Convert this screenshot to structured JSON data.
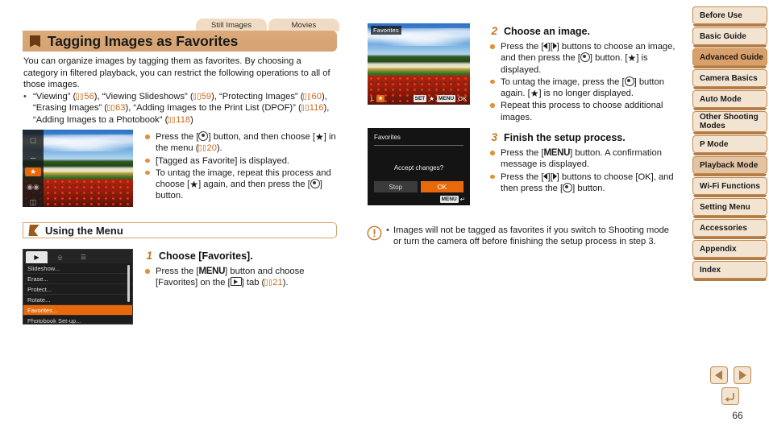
{
  "topic_tabs": [
    {
      "label": "Still Images"
    },
    {
      "label": "Movies"
    }
  ],
  "title": "Tagging Images as Favorites",
  "intro": "You can organize images by tagging them as favorites. By choosing a category in filtered playback, you can restrict the following operations to all of those images.",
  "related_bullet": {
    "parts": [
      {
        "text": "“Viewing” ("
      },
      {
        "ref": "56"
      },
      {
        "text": "), “Viewing Slideshows” ("
      },
      {
        "ref": "59"
      },
      {
        "text": "), “Protecting Images” ("
      },
      {
        "ref": "60"
      },
      {
        "text": "), “Erasing Images” ("
      },
      {
        "ref": "63"
      },
      {
        "text": "), “Adding Images to the Print List (DPOF)” ("
      },
      {
        "ref": "116"
      },
      {
        "text": "), “Adding Images to a Photobook” ("
      },
      {
        "ref": "118"
      },
      {
        "text": ")"
      }
    ]
  },
  "screens": {
    "photo_favorites": {
      "name": "favorites-filter-photo",
      "icons": [
        "folder-icon",
        "date-icon",
        "star-icon",
        "people-icon",
        "file-icon"
      ],
      "selected_icon_index": 2
    },
    "photo_choose": {
      "label": "Favorites",
      "quality_badge": "L",
      "set_chip": "SET",
      "star_glyph": "★",
      "menu_chip": "MENU",
      "ok_label": "OK"
    },
    "accept_changes": {
      "title": "Favorites",
      "message": "Accept changes?",
      "buttons": [
        "Stop",
        "OK"
      ],
      "active_button_index": 1,
      "footer_chip": "MENU",
      "footer_glyph": "↵"
    },
    "menu_list": {
      "tabs": [
        "play-tab",
        "print-tab",
        "settings-tab"
      ],
      "selected_tab_index": 0,
      "rows": [
        "Slideshow...",
        "Erase...",
        "Protect...",
        "Rotate...",
        "Favorites...",
        "Photobook Set-up..."
      ],
      "selected_row_index": 4
    }
  },
  "left_steps": {
    "intro_items": [
      {
        "segments": [
          {
            "text": "Press the ["
          },
          {
            "glyph": "set"
          },
          {
            "text": "] button, and then choose ["
          },
          {
            "glyph": "star"
          },
          {
            "text": "] in the menu ("
          },
          {
            "ref": "20"
          },
          {
            "text": ")."
          }
        ]
      },
      {
        "segments": [
          {
            "text": "[Tagged as Favorite] is displayed."
          }
        ]
      },
      {
        "segments": [
          {
            "text": "To untag the image, repeat this process and choose ["
          },
          {
            "glyph": "star"
          },
          {
            "text": "] again, and then press the ["
          },
          {
            "glyph": "set"
          },
          {
            "text": "] button."
          }
        ]
      }
    ]
  },
  "subsection": {
    "title": "Using the Menu"
  },
  "steps": [
    {
      "number": "1",
      "heading": "Choose [Favorites].",
      "items": [
        {
          "segments": [
            {
              "text": "Press the ["
            },
            {
              "glyph": "menu"
            },
            {
              "text": "] button and choose [Favorites] on the ["
            },
            {
              "glyph": "play"
            },
            {
              "text": "] tab ("
            },
            {
              "ref": "21"
            },
            {
              "text": ")."
            }
          ]
        }
      ]
    },
    {
      "number": "2",
      "heading": "Choose an image.",
      "items": [
        {
          "segments": [
            {
              "text": "Press the ["
            },
            {
              "glyph": "arrow-l"
            },
            {
              "text": "]["
            },
            {
              "glyph": "arrow-r"
            },
            {
              "text": "] buttons to choose an image, and then press the ["
            },
            {
              "glyph": "set"
            },
            {
              "text": "] button. ["
            },
            {
              "glyph": "star"
            },
            {
              "text": "] is displayed."
            }
          ]
        },
        {
          "segments": [
            {
              "text": "To untag the image, press the ["
            },
            {
              "glyph": "set"
            },
            {
              "text": "] button again. ["
            },
            {
              "glyph": "star"
            },
            {
              "text": "] is no longer displayed."
            }
          ]
        },
        {
          "segments": [
            {
              "text": "Repeat this process to choose additional images."
            }
          ]
        }
      ]
    },
    {
      "number": "3",
      "heading": "Finish the setup process.",
      "items": [
        {
          "segments": [
            {
              "text": "Press the ["
            },
            {
              "glyph": "menu"
            },
            {
              "text": "] button. A confirmation message is displayed."
            }
          ]
        },
        {
          "segments": [
            {
              "text": "Press the ["
            },
            {
              "glyph": "arrow-l"
            },
            {
              "text": "]["
            },
            {
              "glyph": "arrow-r"
            },
            {
              "text": "] buttons to choose [OK], and then press the ["
            },
            {
              "glyph": "set"
            },
            {
              "text": "] button."
            }
          ]
        }
      ]
    }
  ],
  "note": {
    "icon": "caution-icon",
    "bullet": "•",
    "text": "Images will not be tagged as favorites if you switch to Shooting mode or turn the camera off before finishing the setup process in step 3."
  },
  "sidebar": {
    "items": [
      {
        "label": "Before Use",
        "style": "normal"
      },
      {
        "label": "Basic Guide",
        "style": "normal"
      },
      {
        "label": "Advanced Guide",
        "style": "active"
      },
      {
        "label": "Camera Basics",
        "style": "normal"
      },
      {
        "label": "Auto Mode",
        "style": "normal"
      },
      {
        "label": "Other Shooting Modes",
        "style": "normal-two-line"
      },
      {
        "label": "P Mode",
        "style": "normal"
      },
      {
        "label": "Playback Mode",
        "style": "group"
      },
      {
        "label": "Wi-Fi Functions",
        "style": "normal"
      },
      {
        "label": "Setting Menu",
        "style": "normal"
      },
      {
        "label": "Accessories",
        "style": "normal"
      },
      {
        "label": "Appendix",
        "style": "normal"
      },
      {
        "label": "Index",
        "style": "normal"
      }
    ]
  },
  "pager": {
    "prev": "prev-page-button",
    "next": "next-page-button",
    "back": "back-button",
    "page_number": "66"
  },
  "colors": {
    "accent_orange": "#e8690c",
    "title_bar": "#d9a571",
    "sidebar_fill": "#f3e4d1",
    "sidebar_border": "#c08a50",
    "ref_link": "#c86a1e"
  }
}
